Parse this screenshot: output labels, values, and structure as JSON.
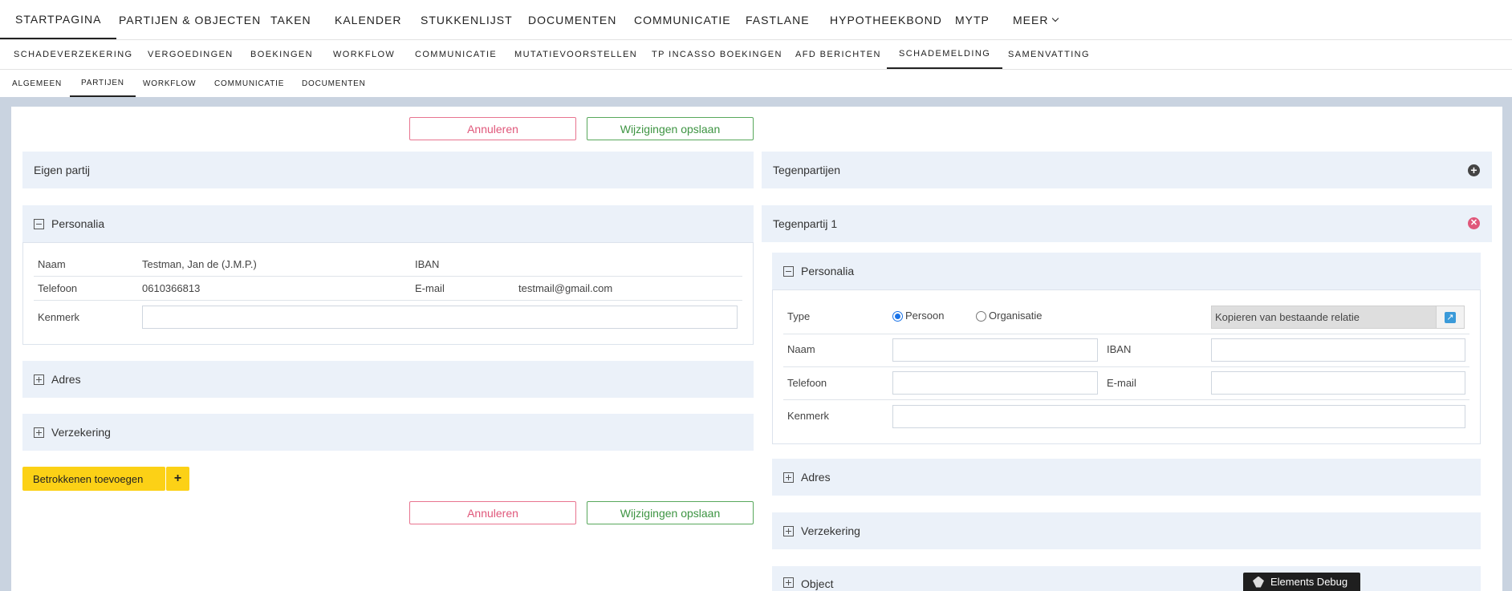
{
  "nav_main": [
    "STARTPAGINA",
    "PARTIJEN & OBJECTEN",
    "TAKEN",
    "KALENDER",
    "STUKKENLIJST",
    "DOCUMENTEN",
    "COMMUNICATIE",
    "FASTLANE",
    "HYPOTHEEKBOND",
    "MYTP",
    "MEER"
  ],
  "nav_sub": [
    "SCHADEVERZEKERING",
    "VERGOEDINGEN",
    "BOEKINGEN",
    "WORKFLOW",
    "COMMUNICATIE",
    "MUTATIEVOORSTELLEN",
    "TP INCASSO BOEKINGEN",
    "AFD BERICHTEN",
    "SCHADEMELDING",
    "SAMENVATTING"
  ],
  "nav_tabs": [
    "ALGEMEEN",
    "PARTIJEN",
    "WORKFLOW",
    "COMMUNICATIE",
    "DOCUMENTEN"
  ],
  "actions": {
    "cancel": "Annuleren",
    "save": "Wijzigingen opslaan"
  },
  "left": {
    "title": "Eigen partij",
    "personalia": {
      "title": "Personalia",
      "naam_label": "Naam",
      "naam_value": "Testman, Jan de (J.M.P.)",
      "iban_label": "IBAN",
      "iban_value": "",
      "telefoon_label": "Telefoon",
      "telefoon_value": "0610366813",
      "email_label": "E-mail",
      "email_value": "testmail@gmail.com",
      "kenmerk_label": "Kenmerk",
      "kenmerk_value": ""
    },
    "adres": "Adres",
    "verzekering": "Verzekering",
    "add_button": "Betrokkenen toevoegen",
    "add_icon": "+"
  },
  "right": {
    "title": "Tegenpartijen",
    "party_title": "Tegenpartij 1",
    "personalia": {
      "title": "Personalia",
      "type_label": "Type",
      "persoon": "Persoon",
      "organisatie": "Organisatie",
      "copy_placeholder": "Kopieren van bestaande relatie",
      "naam_label": "Naam",
      "naam_value": "",
      "iban_label": "IBAN",
      "iban_value": "",
      "telefoon_label": "Telefoon",
      "telefoon_value": "",
      "email_label": "E-mail",
      "email_value": "",
      "kenmerk_label": "Kenmerk",
      "kenmerk_value": ""
    },
    "adres": "Adres",
    "verzekering": "Verzekering",
    "object": "Object"
  },
  "debug": "Elements Debug",
  "icons": {
    "add": "plus-circle-icon",
    "delete": "close-circle-icon",
    "copy": "external-link-icon",
    "collapse": "minus-square-icon",
    "expand": "plus-square-icon"
  },
  "colors": {
    "panel_bg": "#ebf1f9",
    "cancel": "#e0577a",
    "save": "#3d9442",
    "yellow": "#fcd116",
    "page_bg": "#c9d3e0"
  }
}
